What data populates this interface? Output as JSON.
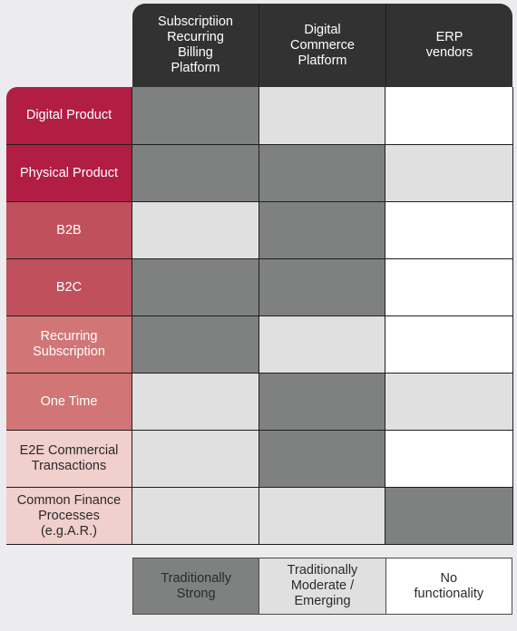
{
  "colors": {
    "header_bg": "#323232",
    "strong": "#7f8180",
    "moderate": "#e0e0e0",
    "none": "#ffffff",
    "label_dark": "#b21d44",
    "label_mid": "#c0505b",
    "label_light": "#d27576",
    "label_pale": "#f0cfcc"
  },
  "columns": [
    "Subscriptiion\nRecurring\nBilling\nPlatform",
    "Digital\nCommerce\nPlatform",
    "ERP\nvendors"
  ],
  "rows": [
    {
      "label": "Digital Product",
      "shade": "label_dark",
      "text_color": "#ffffff",
      "values": [
        "strong",
        "moderate",
        "none"
      ]
    },
    {
      "label": "Physical Product",
      "shade": "label_dark",
      "text_color": "#ffffff",
      "values": [
        "strong",
        "strong",
        "moderate"
      ]
    },
    {
      "label": "B2B",
      "shade": "label_mid",
      "text_color": "#ffffff",
      "values": [
        "moderate",
        "strong",
        "none"
      ]
    },
    {
      "label": "B2C",
      "shade": "label_mid",
      "text_color": "#ffffff",
      "values": [
        "strong",
        "strong",
        "none"
      ]
    },
    {
      "label": "Recurring\nSubscription",
      "shade": "label_light",
      "text_color": "#ffffff",
      "values": [
        "strong",
        "moderate",
        "none"
      ]
    },
    {
      "label": "One Time",
      "shade": "label_light",
      "text_color": "#ffffff",
      "values": [
        "moderate",
        "strong",
        "moderate"
      ]
    },
    {
      "label": "E2E Commercial\nTransactions",
      "shade": "label_pale",
      "text_color": "#2a2a2a",
      "values": [
        "moderate",
        "strong",
        "none"
      ]
    },
    {
      "label": "Common Finance\nProcesses\n(e.g.A.R.)",
      "shade": "label_pale",
      "text_color": "#2a2a2a",
      "values": [
        "moderate",
        "moderate",
        "strong"
      ]
    }
  ],
  "legend": [
    {
      "key": "strong",
      "label": "Traditionally\nStrong"
    },
    {
      "key": "moderate",
      "label": "Traditionally\nModerate /\nEmerging"
    },
    {
      "key": "none",
      "label": "No\nfunctionality"
    }
  ]
}
